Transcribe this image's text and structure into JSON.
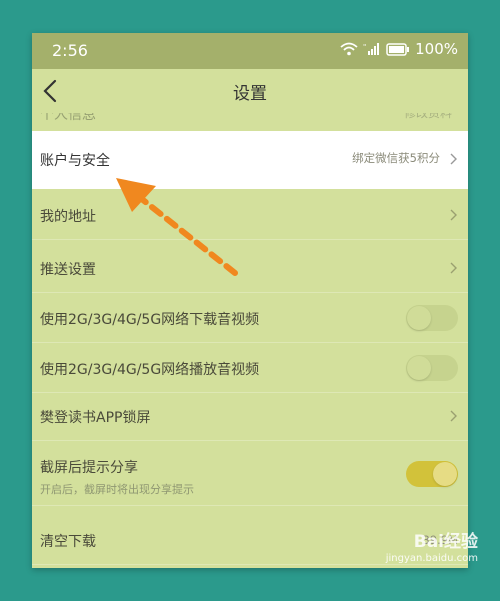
{
  "status": {
    "time": "2:56",
    "battery": "100%"
  },
  "header": {
    "title": "设置"
  },
  "partial_row": {
    "label": "个人信息",
    "value": "修改资料"
  },
  "rows": [
    {
      "label": "账户与安全",
      "value": "绑定微信获5积分",
      "type": "link"
    },
    {
      "label": "我的地址",
      "type": "link"
    },
    {
      "label": "推送设置",
      "type": "link"
    },
    {
      "label": "使用2G/3G/4G/5G网络下载音视频",
      "type": "toggle",
      "on": false
    },
    {
      "label": "使用2G/3G/4G/5G网络播放音视频",
      "type": "toggle",
      "on": false
    },
    {
      "label": "樊登读书APP锁屏",
      "type": "link"
    },
    {
      "label": "截屏后提示分享",
      "sub": "开启后，截屏时将出现分享提示",
      "type": "toggle",
      "on": true
    },
    {
      "label": "清空下载",
      "value": "39.9M",
      "type": "value"
    }
  ],
  "watermark": {
    "logo": "Bai经验",
    "url": "jingyan.baidu.com"
  },
  "colors": {
    "annotation_arrow": "#f0881f",
    "toggle_on": "#d2c23a",
    "highlight_row": "#ffffff"
  }
}
